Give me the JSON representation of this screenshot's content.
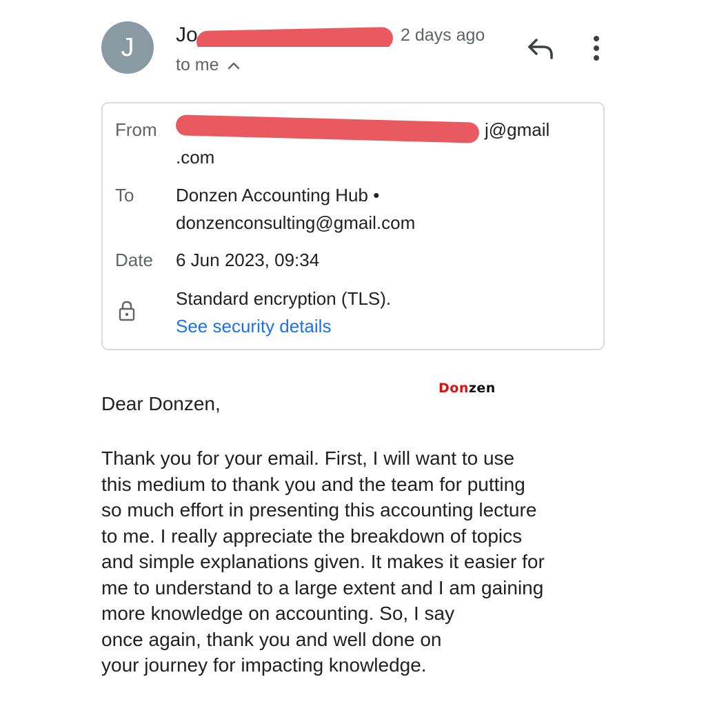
{
  "header": {
    "avatar_letter": "J",
    "sender_visible_prefix": "Jo",
    "time": "2 days ago",
    "recipient_summary": "to me",
    "reply_icon": "reply-icon",
    "more_icon": "more-vert-icon",
    "collapse_icon": "chevron-up-icon"
  },
  "details": {
    "from_label": "From",
    "from_value_suffix": "j@gmail",
    "from_value_line2": ".com",
    "to_label": "To",
    "to_name": "Donzen Accounting Hub •",
    "to_email": "donzenconsulting@gmail.com",
    "date_label": "Date",
    "date_value": "6 Jun 2023, 09:34",
    "security_icon": "lock-icon",
    "security_text": "Standard encryption (TLS).",
    "security_link": "See security details"
  },
  "watermark": {
    "part1": "Don",
    "part2": "zen"
  },
  "body": {
    "greeting": "Dear Donzen,",
    "lines": [
      "Thank you for your email. First, I will want to use",
      "this medium to thank you and the team for putting",
      "so much effort in presenting this accounting lecture",
      "to me. I really appreciate the breakdown of topics",
      "and simple explanations given. It makes it easier for",
      "me to understand to a large extent and I am gaining",
      "more knowledge on accounting. So, I say",
      "once again, thank you and well done on",
      "your journey for impacting knowledge."
    ]
  },
  "colors": {
    "avatar_bg": "#8a9aa3",
    "redaction": "#e85a5f",
    "link": "#1a73e8",
    "watermark_red": "#e01010"
  }
}
